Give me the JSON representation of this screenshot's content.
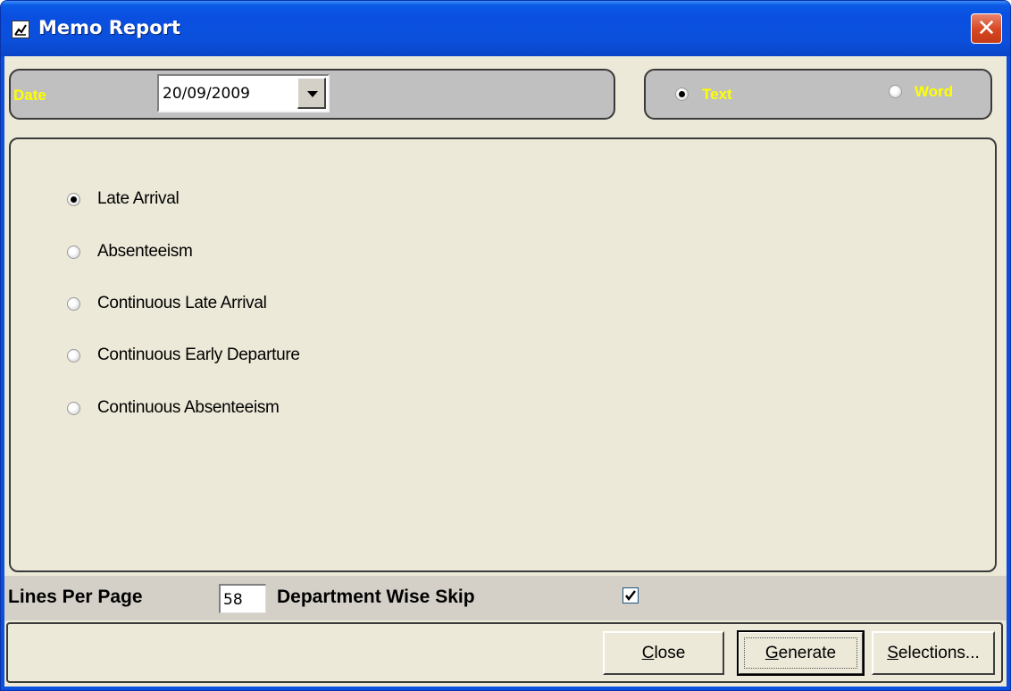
{
  "window": {
    "title": "Memo Report",
    "close_glyph": "✕"
  },
  "date_group": {
    "label": "Date",
    "value": "20/09/2009"
  },
  "format_group": {
    "options": [
      {
        "label": "Text",
        "selected": true
      },
      {
        "label": "Word",
        "selected": false
      }
    ]
  },
  "report_options": [
    {
      "label": "Late Arrival",
      "selected": true
    },
    {
      "label": "Absenteeism",
      "selected": false
    },
    {
      "label": "Continuous Late Arrival",
      "selected": false
    },
    {
      "label": "Continuous Early Departure",
      "selected": false
    },
    {
      "label": "Continuous Absenteeism",
      "selected": false
    }
  ],
  "settings": {
    "lines_per_page_label": "Lines Per Page",
    "lines_per_page_value": "58",
    "dept_skip_label": "Department Wise Skip",
    "dept_skip_checked": true
  },
  "buttons": {
    "close": {
      "mnemonic": "C",
      "rest": "lose"
    },
    "generate": {
      "mnemonic": "G",
      "rest": "enerate"
    },
    "selections": {
      "mnemonic": "S",
      "rest": "elections..."
    }
  },
  "colors": {
    "title_bar": "#0a4fe0",
    "label_yellow": "#ffff00",
    "panel_gray": "#c0c0c0",
    "face": "#ece9d8"
  }
}
